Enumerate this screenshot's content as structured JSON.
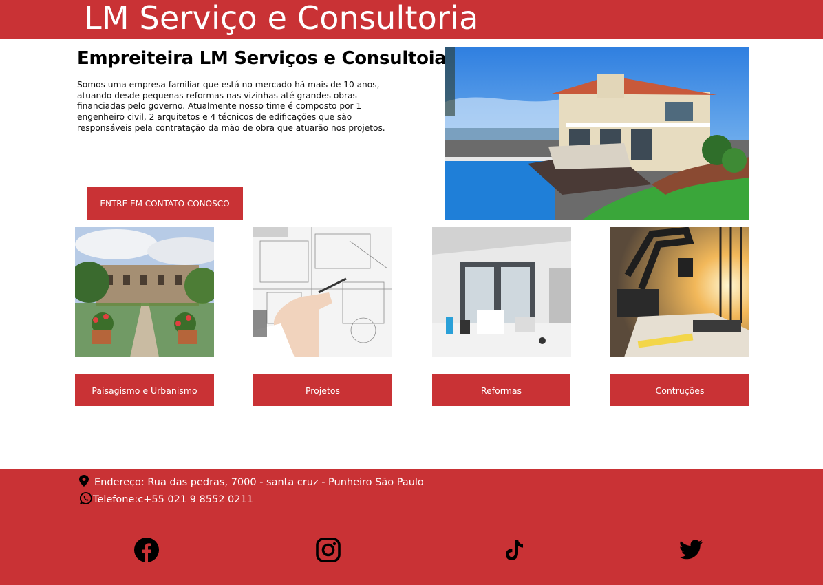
{
  "header": {
    "brand": "LM Serviço e Consultoria"
  },
  "hero": {
    "title": "Empreiteira LM Serviços e Consultoia",
    "description": "Somos uma empresa familiar que está no mercado há mais de 10 anos, atuando desde pequenas reformas nas vizinhas até grandes obras financiadas pelo governo. Atualmente nosso time é composto por 1 engenheiro civil, 2 arquitetos e 4 técnicos de edificações que são responsáveis pela contratação da mão de obra que atuarão nos projetos.",
    "cta_label": "ENTRE EM CONTATO CONOSCO",
    "image_icon": "villa-pool-photo"
  },
  "services": [
    {
      "label": "Paisagismo e Urbanismo",
      "image_icon": "garden-photo"
    },
    {
      "label": "Projetos",
      "image_icon": "blueprint-photo"
    },
    {
      "label": "Reformas",
      "image_icon": "renovation-room-photo"
    },
    {
      "label": "Contruções",
      "image_icon": "excavator-photo"
    }
  ],
  "footer": {
    "address": "Endereço: Rua das pedras, 7000 - santa cruz - Punheiro São Paulo",
    "phone": "Telefone:c+55 021 9 8552 0211",
    "address_icon": "location-pin-icon",
    "phone_icon": "whatsapp-icon",
    "social": [
      "facebook-icon",
      "instagram-icon",
      "tiktok-icon",
      "twitter-icon"
    ]
  },
  "colors": {
    "brand_red": "#c93235",
    "white": "#ffffff",
    "text": "#000000"
  }
}
